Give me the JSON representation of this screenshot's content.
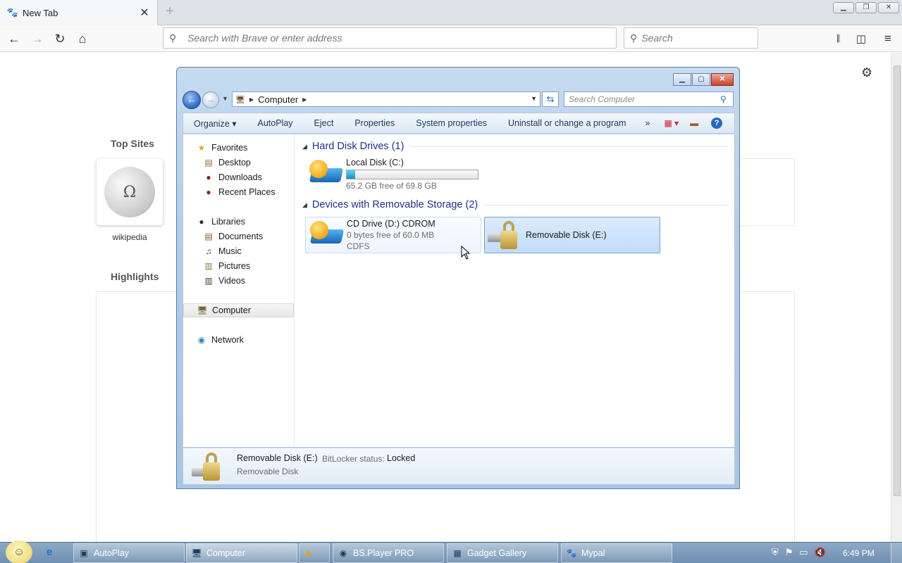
{
  "browser": {
    "tab_title": "New Tab",
    "url_placeholder": "Search with Brave or enter address",
    "search_placeholder": "Search"
  },
  "newtab": {
    "top_sites_label": "Top Sites",
    "highlights_label": "Highlights",
    "sites": [
      {
        "label": "wikipedia"
      }
    ]
  },
  "explorer": {
    "breadcrumb": "Computer",
    "search_placeholder": "Search Computer",
    "commands": [
      "Organize",
      "AutoPlay",
      "Eject",
      "Properties",
      "System properties",
      "Uninstall or change a program"
    ],
    "more_label": "»",
    "nav": {
      "favorites": "Favorites",
      "favorites_items": [
        "Desktop",
        "Downloads",
        "Recent Places"
      ],
      "libraries": "Libraries",
      "libraries_items": [
        "Documents",
        "Music",
        "Pictures",
        "Videos"
      ],
      "computer": "Computer",
      "network": "Network"
    },
    "groups": {
      "hdd_title": "Hard Disk Drives (1)",
      "removable_title": "Devices with Removable Storage (2)"
    },
    "drives": {
      "local": {
        "name": "Local Disk (C:)",
        "free": "65.2 GB free of 69.8 GB",
        "used_fraction": 0.066
      },
      "cd": {
        "name": "CD Drive (D:) CDROM",
        "free": "0 bytes free of 60.0 MB",
        "fs": "CDFS"
      },
      "removable": {
        "name": "Removable Disk (E:)"
      }
    },
    "details": {
      "name": "Removable Disk (E:)",
      "bitlocker_label": "BitLocker status:",
      "bitlocker_value": "Locked",
      "type": "Removable Disk"
    }
  },
  "taskbar": {
    "items": [
      "AutoPlay",
      "Computer",
      "BS.Player PRO",
      "Gadget Gallery",
      "Mypal"
    ],
    "clock": "6:49 PM"
  }
}
